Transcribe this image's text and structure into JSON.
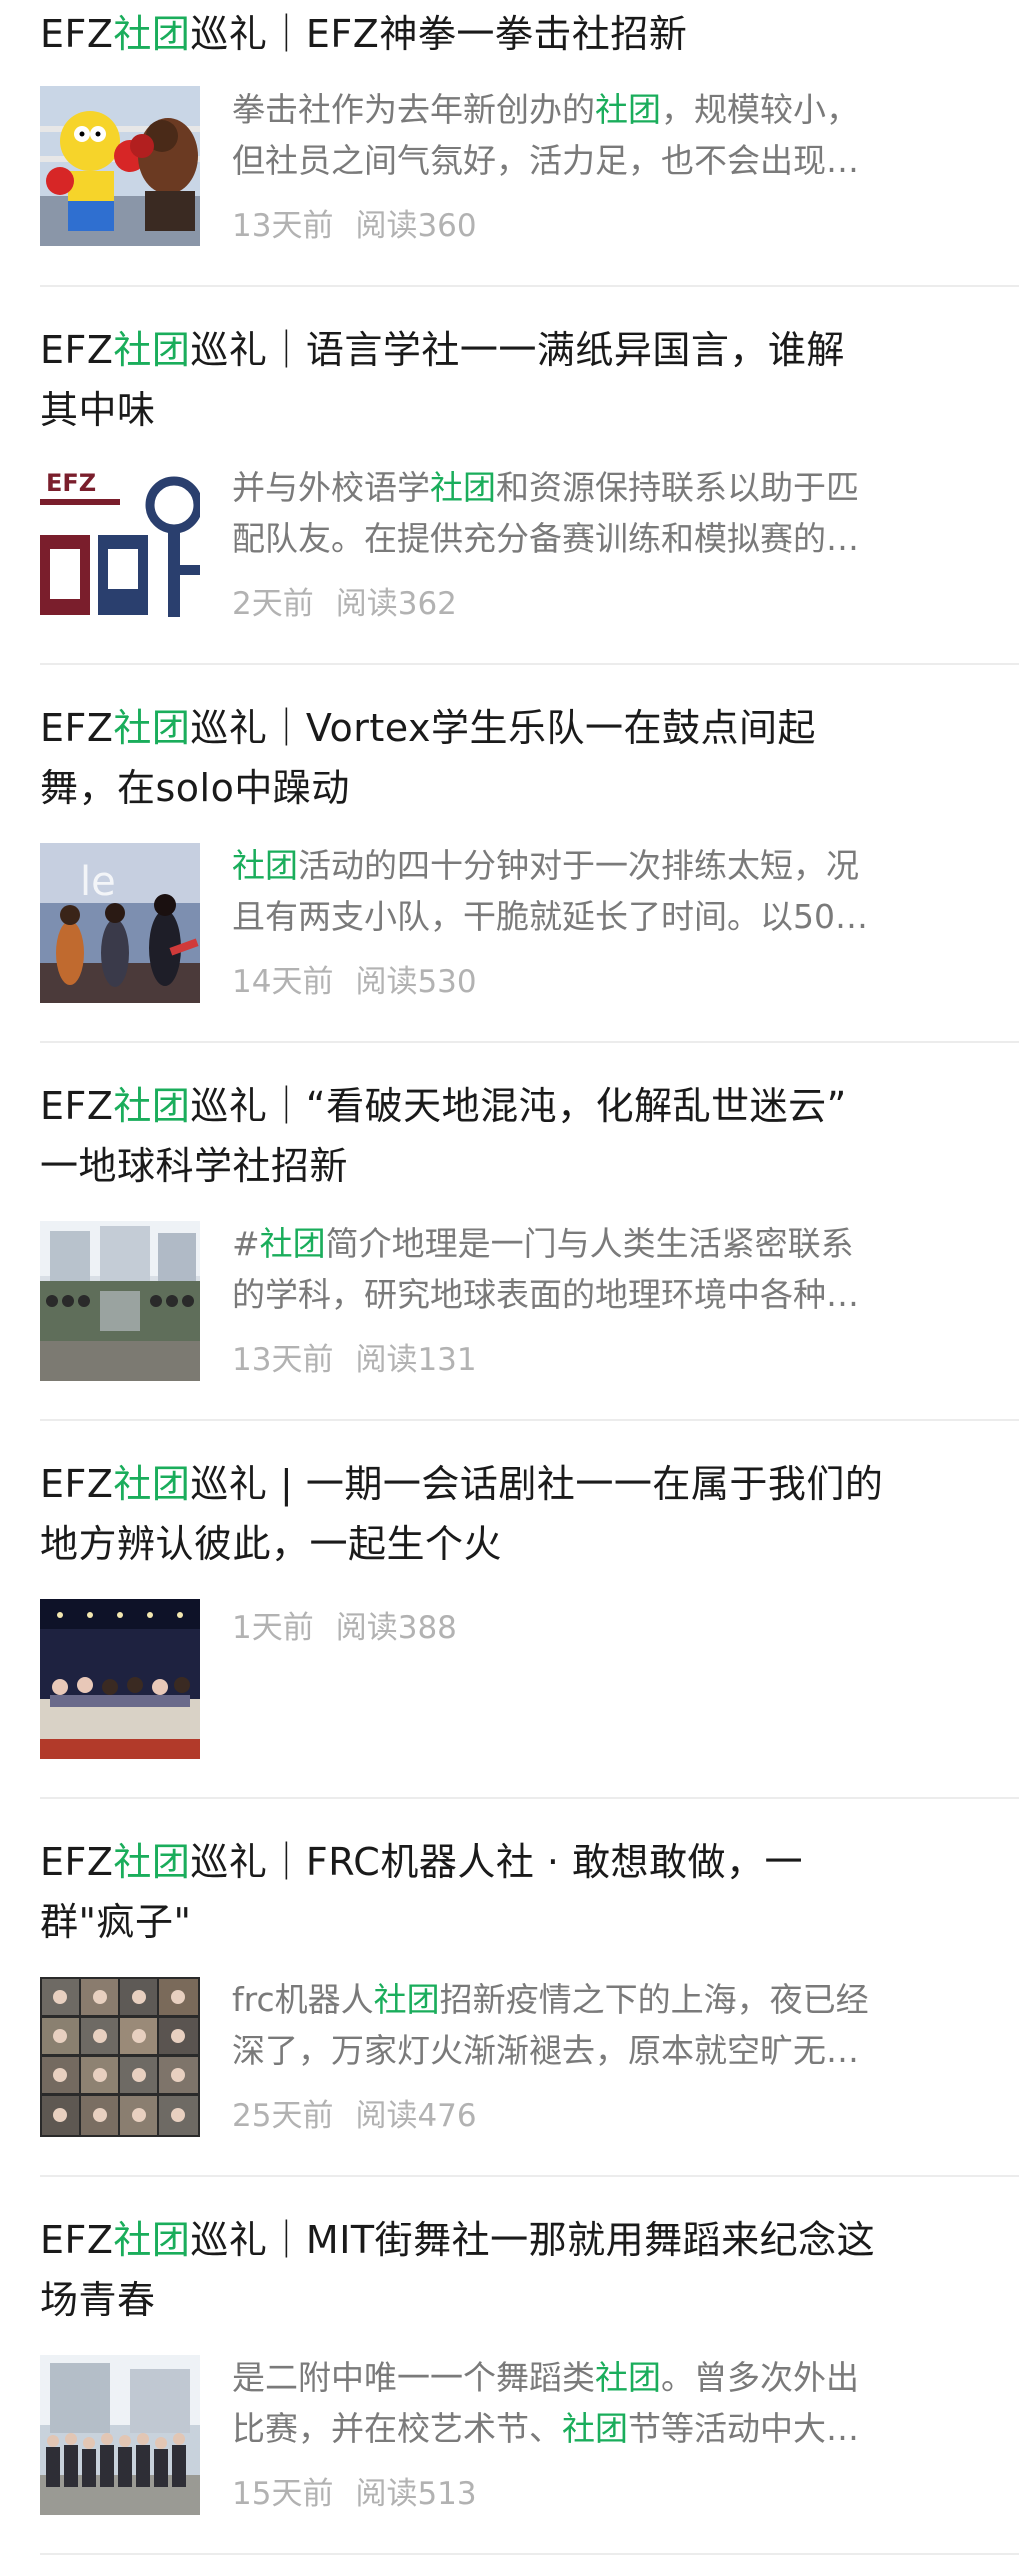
{
  "articles": [
    {
      "title_prefix": "EFZ",
      "title_hl": "社团",
      "title_rest": "巡礼｜EFZ神拳一拳击社招新",
      "title_rest2": "",
      "snippet_line1_a": "拳击社作为去年新创办的",
      "snippet_line1_hl": "社团",
      "snippet_line1_b": "，规模较小，",
      "snippet_line2_a": "但社员之间气氛好，活力足，也不会出现…",
      "snippet_line2_hl": "",
      "snippet_line2_b": "",
      "time": "13天前",
      "reads": "阅读360",
      "thumb_icon": "boxing-cartoon-image"
    },
    {
      "title_prefix": "EFZ",
      "title_hl": "社团",
      "title_rest": "巡礼｜语言学社一一满纸异国言，谁解",
      "title_rest2": "其中味",
      "snippet_line1_a": "并与外校语学",
      "snippet_line1_hl": "社团",
      "snippet_line1_b": "和资源保持联系以助于匹",
      "snippet_line2_a": "配队友。在提供充分备赛训练和模拟赛的…",
      "snippet_line2_hl": "",
      "snippet_line2_b": "",
      "time": "2天前",
      "reads": "阅读362",
      "thumb_icon": "linguistics-logo-image"
    },
    {
      "title_prefix": "EFZ",
      "title_hl": "社团",
      "title_rest": "巡礼｜Vortex学生乐队一在鼓点间起",
      "title_rest2": "舞，在solo中躁动",
      "snippet_line1_a": "",
      "snippet_line1_hl": "社团",
      "snippet_line1_b": "活动的四十分钟对于一次排练太短，况",
      "snippet_line2_a": "且有两支小队，干脆就延长了时间。以50…",
      "snippet_line2_hl": "",
      "snippet_line2_b": "",
      "time": "14天前",
      "reads": "阅读530",
      "thumb_icon": "band-stage-image"
    },
    {
      "title_prefix": "EFZ",
      "title_hl": "社团",
      "title_rest": "巡礼｜“看破天地混沌，化解乱世迷云”",
      "title_rest2": "一地球科学社招新",
      "snippet_line1_a": "#",
      "snippet_line1_hl": "社团",
      "snippet_line1_b": "简介地理是一门与人类生活紧密联系",
      "snippet_line2_a": "的学科，研究地球表面的地理环境中各种…",
      "snippet_line2_hl": "",
      "snippet_line2_b": "",
      "time": "13天前",
      "reads": "阅读131",
      "thumb_icon": "school-group-photo-image"
    },
    {
      "title_prefix": "EFZ",
      "title_hl": "社团",
      "title_rest": "巡礼 | 一期一会话剧社一一在属于我们的",
      "title_rest2": "地方辨认彼此，一起生个火",
      "snippet_line1_a": "",
      "snippet_line1_hl": "",
      "snippet_line1_b": "",
      "snippet_line2_a": "",
      "snippet_line2_hl": "",
      "snippet_line2_b": "",
      "time": "1天前",
      "reads": "阅读388",
      "thumb_icon": "drama-stage-image"
    },
    {
      "title_prefix": "EFZ",
      "title_hl": "社团",
      "title_rest": "巡礼｜FRC机器人社 · 敢想敢做，一",
      "title_rest2": "群\"疯子\"",
      "snippet_line1_a": "frc机器人",
      "snippet_line1_hl": "社团",
      "snippet_line1_b": "招新疫情之下的上海，夜已经",
      "snippet_line2_a": "深了，万家灯火渐渐褪去，原本就空旷无…",
      "snippet_line2_hl": "",
      "snippet_line2_b": "",
      "time": "25天前",
      "reads": "阅读476",
      "thumb_icon": "video-call-grid-image"
    },
    {
      "title_prefix": "EFZ",
      "title_hl": "社团",
      "title_rest": "巡礼｜MIT街舞社一那就用舞蹈来纪念这",
      "title_rest2": "场青春",
      "snippet_line1_a": "是二附中唯一一个舞蹈类",
      "snippet_line1_hl": "社团",
      "snippet_line1_b": "。曾多次外出",
      "snippet_line2_a": "比赛，并在校艺术节、",
      "snippet_line2_hl": "社团",
      "snippet_line2_b": "节等活动中大…",
      "time": "15天前",
      "reads": "阅读513",
      "thumb_icon": "dance-group-photo-image"
    }
  ],
  "colors": {
    "highlight": "#1aad5b",
    "title": "#1a1a1a",
    "snippet": "#7a7a7a",
    "meta": "#b2b2b2",
    "divider": "#ececec"
  }
}
